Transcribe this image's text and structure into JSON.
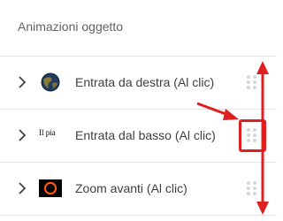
{
  "panel": {
    "title": "Animazioni oggetto"
  },
  "animations": [
    {
      "thumbnail": "globe-icon",
      "label": "Entrata da destra  (Al clic)"
    },
    {
      "thumbnail": "text-thumbnail",
      "thumbnail_text": "Il pia",
      "label": "Entrata dal basso  (Al clic)"
    },
    {
      "thumbnail": "eclipse-icon",
      "label": "Zoom avanti  (Al clic)"
    }
  ],
  "colors": {
    "annotation": "#e02020",
    "divider": "#e3e3e3",
    "text": "#3c4043",
    "title": "#5f6368",
    "drag_dots": "#d3d6da"
  }
}
